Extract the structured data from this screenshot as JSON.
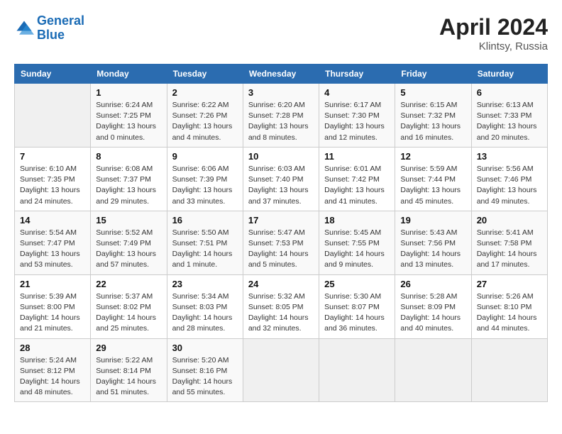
{
  "logo": {
    "line1": "General",
    "line2": "Blue"
  },
  "title": "April 2024",
  "subtitle": "Klintsy, Russia",
  "days_header": [
    "Sunday",
    "Monday",
    "Tuesday",
    "Wednesday",
    "Thursday",
    "Friday",
    "Saturday"
  ],
  "weeks": [
    [
      {
        "day": "",
        "info": ""
      },
      {
        "day": "1",
        "info": "Sunrise: 6:24 AM\nSunset: 7:25 PM\nDaylight: 13 hours\nand 0 minutes."
      },
      {
        "day": "2",
        "info": "Sunrise: 6:22 AM\nSunset: 7:26 PM\nDaylight: 13 hours\nand 4 minutes."
      },
      {
        "day": "3",
        "info": "Sunrise: 6:20 AM\nSunset: 7:28 PM\nDaylight: 13 hours\nand 8 minutes."
      },
      {
        "day": "4",
        "info": "Sunrise: 6:17 AM\nSunset: 7:30 PM\nDaylight: 13 hours\nand 12 minutes."
      },
      {
        "day": "5",
        "info": "Sunrise: 6:15 AM\nSunset: 7:32 PM\nDaylight: 13 hours\nand 16 minutes."
      },
      {
        "day": "6",
        "info": "Sunrise: 6:13 AM\nSunset: 7:33 PM\nDaylight: 13 hours\nand 20 minutes."
      }
    ],
    [
      {
        "day": "7",
        "info": "Sunrise: 6:10 AM\nSunset: 7:35 PM\nDaylight: 13 hours\nand 24 minutes."
      },
      {
        "day": "8",
        "info": "Sunrise: 6:08 AM\nSunset: 7:37 PM\nDaylight: 13 hours\nand 29 minutes."
      },
      {
        "day": "9",
        "info": "Sunrise: 6:06 AM\nSunset: 7:39 PM\nDaylight: 13 hours\nand 33 minutes."
      },
      {
        "day": "10",
        "info": "Sunrise: 6:03 AM\nSunset: 7:40 PM\nDaylight: 13 hours\nand 37 minutes."
      },
      {
        "day": "11",
        "info": "Sunrise: 6:01 AM\nSunset: 7:42 PM\nDaylight: 13 hours\nand 41 minutes."
      },
      {
        "day": "12",
        "info": "Sunrise: 5:59 AM\nSunset: 7:44 PM\nDaylight: 13 hours\nand 45 minutes."
      },
      {
        "day": "13",
        "info": "Sunrise: 5:56 AM\nSunset: 7:46 PM\nDaylight: 13 hours\nand 49 minutes."
      }
    ],
    [
      {
        "day": "14",
        "info": "Sunrise: 5:54 AM\nSunset: 7:47 PM\nDaylight: 13 hours\nand 53 minutes."
      },
      {
        "day": "15",
        "info": "Sunrise: 5:52 AM\nSunset: 7:49 PM\nDaylight: 13 hours\nand 57 minutes."
      },
      {
        "day": "16",
        "info": "Sunrise: 5:50 AM\nSunset: 7:51 PM\nDaylight: 14 hours\nand 1 minute."
      },
      {
        "day": "17",
        "info": "Sunrise: 5:47 AM\nSunset: 7:53 PM\nDaylight: 14 hours\nand 5 minutes."
      },
      {
        "day": "18",
        "info": "Sunrise: 5:45 AM\nSunset: 7:55 PM\nDaylight: 14 hours\nand 9 minutes."
      },
      {
        "day": "19",
        "info": "Sunrise: 5:43 AM\nSunset: 7:56 PM\nDaylight: 14 hours\nand 13 minutes."
      },
      {
        "day": "20",
        "info": "Sunrise: 5:41 AM\nSunset: 7:58 PM\nDaylight: 14 hours\nand 17 minutes."
      }
    ],
    [
      {
        "day": "21",
        "info": "Sunrise: 5:39 AM\nSunset: 8:00 PM\nDaylight: 14 hours\nand 21 minutes."
      },
      {
        "day": "22",
        "info": "Sunrise: 5:37 AM\nSunset: 8:02 PM\nDaylight: 14 hours\nand 25 minutes."
      },
      {
        "day": "23",
        "info": "Sunrise: 5:34 AM\nSunset: 8:03 PM\nDaylight: 14 hours\nand 28 minutes."
      },
      {
        "day": "24",
        "info": "Sunrise: 5:32 AM\nSunset: 8:05 PM\nDaylight: 14 hours\nand 32 minutes."
      },
      {
        "day": "25",
        "info": "Sunrise: 5:30 AM\nSunset: 8:07 PM\nDaylight: 14 hours\nand 36 minutes."
      },
      {
        "day": "26",
        "info": "Sunrise: 5:28 AM\nSunset: 8:09 PM\nDaylight: 14 hours\nand 40 minutes."
      },
      {
        "day": "27",
        "info": "Sunrise: 5:26 AM\nSunset: 8:10 PM\nDaylight: 14 hours\nand 44 minutes."
      }
    ],
    [
      {
        "day": "28",
        "info": "Sunrise: 5:24 AM\nSunset: 8:12 PM\nDaylight: 14 hours\nand 48 minutes."
      },
      {
        "day": "29",
        "info": "Sunrise: 5:22 AM\nSunset: 8:14 PM\nDaylight: 14 hours\nand 51 minutes."
      },
      {
        "day": "30",
        "info": "Sunrise: 5:20 AM\nSunset: 8:16 PM\nDaylight: 14 hours\nand 55 minutes."
      },
      {
        "day": "",
        "info": ""
      },
      {
        "day": "",
        "info": ""
      },
      {
        "day": "",
        "info": ""
      },
      {
        "day": "",
        "info": ""
      }
    ]
  ]
}
